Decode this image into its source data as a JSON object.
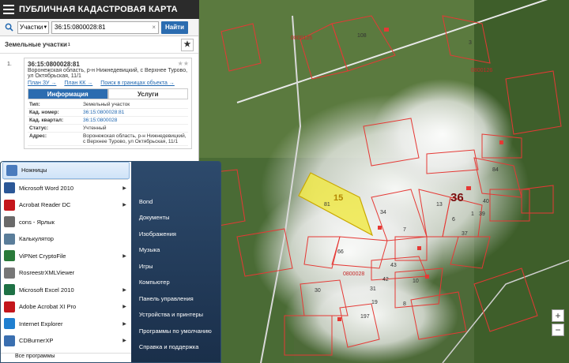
{
  "app": {
    "title": "ПУБЛИЧНАЯ КАДАСТРОВАЯ КАРТА"
  },
  "search": {
    "type_value": "Участки",
    "query": "36:15:0800028:81",
    "find_label": "Найти"
  },
  "results": {
    "header": "Земельные участки",
    "count": "1",
    "item": {
      "index": "1.",
      "cad_number": "36:15:0800028:81",
      "address": "Воронежская область, р-н Нижнедевицкий, с Верхнее Турово, ул Октябрьская, 11/1",
      "link_plan_zu": "План ЗУ →",
      "link_plan_kk": "План КК →",
      "link_object": "Поиск в границах объекта →"
    },
    "tabs": [
      "Информация",
      "Услуги"
    ],
    "info": [
      {
        "k": "Тип:",
        "v": "Земельный участок"
      },
      {
        "k": "Кад. номер:",
        "v": "36:15:0800028:81"
      },
      {
        "k": "Кад. квартал:",
        "v": "36:15:0800028"
      },
      {
        "k": "Статус:",
        "v": "Учтенный"
      },
      {
        "k": "Адрес:",
        "v": "Воронежская область, р-н Нижнедевицкий, с Верхнее Турово, ул Октябрьская, 11/1"
      }
    ]
  },
  "start_menu": {
    "programs": [
      {
        "label": "Ножницы",
        "icon": "scissors-icon",
        "color": "#4a7bbd",
        "arrow": false
      },
      {
        "label": "Microsoft Word 2010",
        "icon": "word-icon",
        "color": "#2b5797",
        "arrow": true
      },
      {
        "label": "Acrobat Reader DC",
        "icon": "acrobat-icon",
        "color": "#c4161c",
        "arrow": true
      },
      {
        "label": "cons - Ярлык",
        "icon": "cons-icon",
        "color": "#6a6a6a",
        "arrow": false
      },
      {
        "label": "Калькулятор",
        "icon": "calculator-icon",
        "color": "#5a7d9a",
        "arrow": false
      },
      {
        "label": "ViPNet CryptoFile",
        "icon": "vipnet-icon",
        "color": "#2a7a3a",
        "arrow": true
      },
      {
        "label": "RosreestrXMLViewer",
        "icon": "xmlviewer-icon",
        "color": "#777777",
        "arrow": false
      },
      {
        "label": "Microsoft Excel 2010",
        "icon": "excel-icon",
        "color": "#1e7145",
        "arrow": true
      },
      {
        "label": "Adobe Acrobat XI Pro",
        "icon": "acrobat-pro-icon",
        "color": "#c4161c",
        "arrow": true
      },
      {
        "label": "Internet Explorer",
        "icon": "ie-icon",
        "color": "#1f7fd0",
        "arrow": true
      },
      {
        "label": "CDBurnerXP",
        "icon": "cdburner-icon",
        "color": "#3a6fb0",
        "arrow": true
      }
    ],
    "all_programs": "Все программы",
    "places": [
      "Bond",
      "Документы",
      "Изображения",
      "Музыка",
      "Игры",
      "Компьютер",
      "Панель управления",
      "Устройства и принтеры",
      "Программы по умолчанию",
      "Справка и поддержка"
    ]
  },
  "map": {
    "labels": [
      "0800125",
      "0800126",
      "0800028",
      "108",
      "3",
      "84",
      "36",
      "15",
      "81",
      "34",
      "7",
      "13",
      "40",
      "39",
      "37",
      "66",
      "43",
      "42",
      "31",
      "10",
      "8",
      "19",
      "197",
      "30",
      "6",
      "1"
    ]
  },
  "zoom": {
    "in": "+",
    "out": "−"
  }
}
